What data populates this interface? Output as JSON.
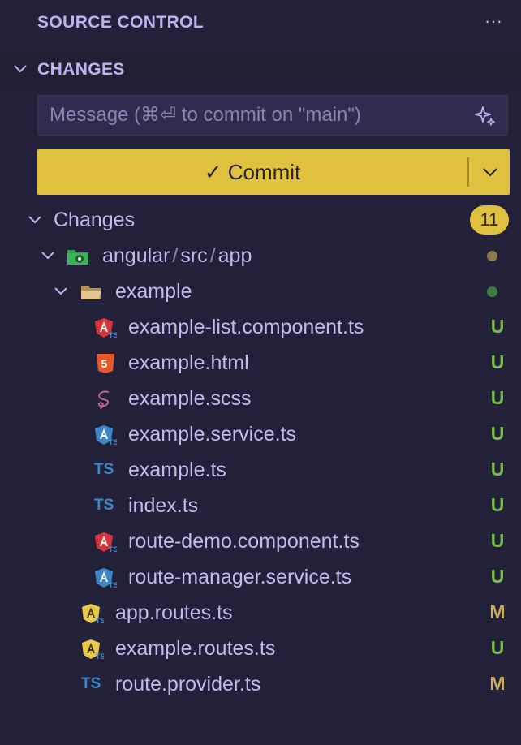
{
  "header": {
    "title": "SOURCE CONTROL",
    "more_label": "···"
  },
  "section": {
    "title": "CHANGES"
  },
  "message": {
    "placeholder": "Message (⌘⏎ to commit on \"main\")",
    "value": ""
  },
  "commit": {
    "label": "✓ Commit"
  },
  "changes_group": {
    "label": "Changes",
    "count": "11"
  },
  "folders": [
    {
      "path": [
        "angular",
        "src",
        "app"
      ],
      "dot_color": "#8c7a4a",
      "icon": "angular-app-folder-icon"
    },
    {
      "label": "example",
      "dot_color": "#3f7a3f",
      "icon": "folder-open-icon"
    }
  ],
  "files": [
    {
      "name": "example-list.component.ts",
      "status": "U",
      "icon": "angular-component-icon"
    },
    {
      "name": "example.html",
      "status": "U",
      "icon": "html5-icon"
    },
    {
      "name": "example.scss",
      "status": "U",
      "icon": "sass-icon"
    },
    {
      "name": "example.service.ts",
      "status": "U",
      "icon": "angular-service-icon"
    },
    {
      "name": "example.ts",
      "status": "U",
      "icon": "typescript-icon"
    },
    {
      "name": "index.ts",
      "status": "U",
      "icon": "typescript-icon"
    },
    {
      "name": "route-demo.component.ts",
      "status": "U",
      "icon": "angular-component-icon"
    },
    {
      "name": "route-manager.service.ts",
      "status": "U",
      "icon": "angular-service-icon"
    },
    {
      "name": "app.routes.ts",
      "status": "M",
      "icon": "angular-routing-icon"
    },
    {
      "name": "example.routes.ts",
      "status": "U",
      "icon": "angular-routing-icon"
    },
    {
      "name": "route.provider.ts",
      "status": "M",
      "icon": "typescript-icon"
    }
  ],
  "colors": {
    "background": "#23213a",
    "accent": "#e0c03f",
    "untracked": "#76c045",
    "modified": "#c9a95a"
  }
}
